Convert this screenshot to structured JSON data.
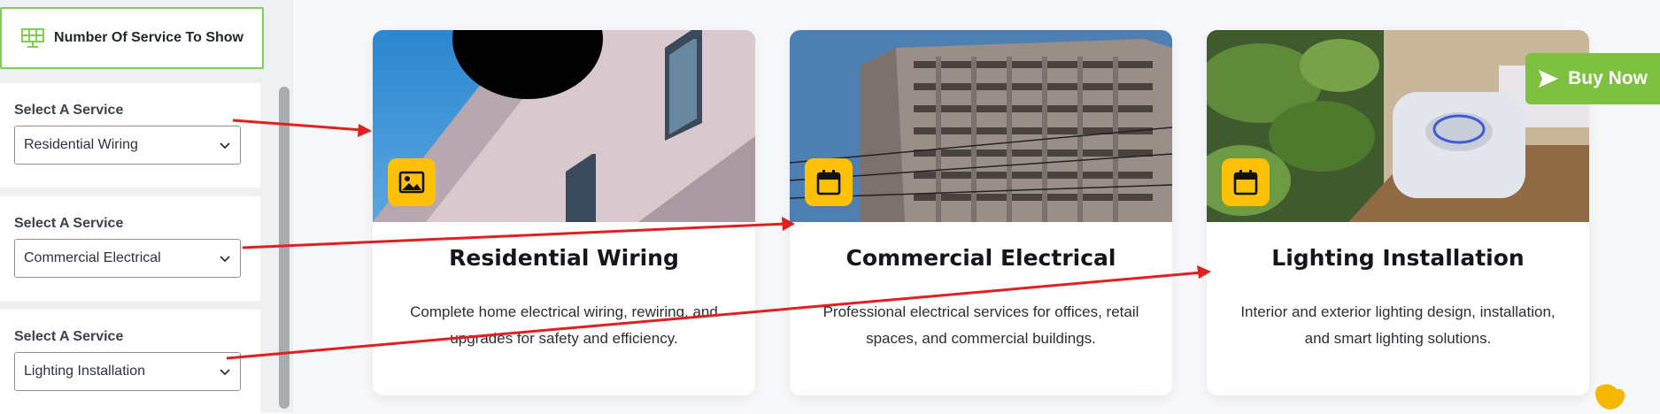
{
  "sidebar": {
    "header_title": "Number Of Service To Show",
    "services": [
      {
        "label": "Select A Service",
        "value": "Residential Wiring"
      },
      {
        "label": "Select A Service",
        "value": "Commercial Electrical"
      },
      {
        "label": "Select A Service",
        "value": "Lighting Installation"
      }
    ]
  },
  "cards": [
    {
      "title": "Residential Wiring",
      "description": "Complete home electrical wiring, rewiring, and upgrades for safety and efficiency.",
      "badge_icon": "image-icon"
    },
    {
      "title": "Commercial Electrical",
      "description": "Professional electrical services for offices, retail spaces, and commercial buildings.",
      "badge_icon": "calendar-icon"
    },
    {
      "title": "Lighting Installation",
      "description": "Interior and exterior lighting design, installation, and smart lighting solutions.",
      "badge_icon": "calendar-icon"
    }
  ],
  "buy_now": {
    "label": "Buy Now",
    "icon": "paper-plane-icon"
  },
  "colors": {
    "accent_green": "#7ed14f",
    "badge_yellow": "#ffc107",
    "arrow_red": "#e0201f",
    "buy_green": "#7ec141"
  }
}
